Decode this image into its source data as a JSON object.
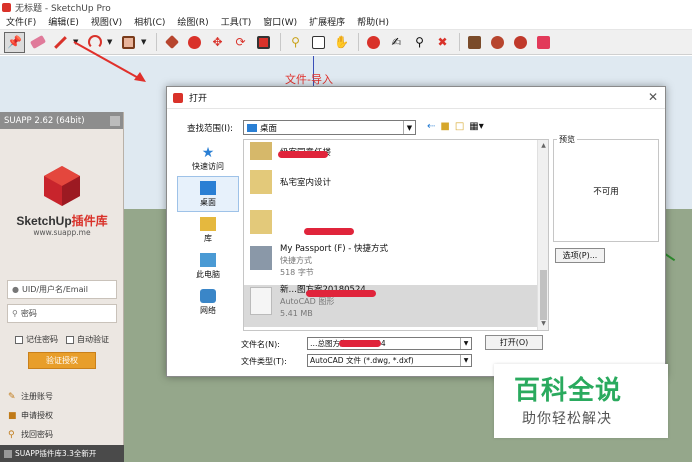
{
  "window": {
    "title": "无标题 - SketchUp Pro"
  },
  "menu": [
    "文件(F)",
    "编辑(E)",
    "视图(V)",
    "相机(C)",
    "绘图(R)",
    "工具(T)",
    "窗口(W)",
    "扩展程序",
    "帮助(H)"
  ],
  "annotation": {
    "text": "文件-导入",
    "color": "#e0302b"
  },
  "suapp": {
    "title": "SUAPP 2.62 (64bit)",
    "brand": "SketchUp",
    "brand_cn": "插件库",
    "url": "www.suapp.me",
    "uid_placeholder": "UID/用户名/Email",
    "password_placeholder": "密码",
    "remember_label": "记住密码",
    "auto_verify_label": "自动验证",
    "auth_button": "验证授权",
    "links": [
      "注册账号",
      "申请授权",
      "找回密码"
    ],
    "footer": "SUAPP插件库3.3全新开",
    "accent_color": "#e89e2a"
  },
  "dialog": {
    "title": "打开",
    "look_in_label": "查找范围(I):",
    "look_in_value": "桌面",
    "places": [
      "快速访问",
      "桌面",
      "库",
      "此电脑",
      "网络"
    ],
    "files": [
      {
        "name": "级客同意任楼",
        "sub": []
      },
      {
        "name": "私宅室内设计",
        "sub": []
      },
      {
        "name": "",
        "sub": []
      },
      {
        "name": "My Passport (F) - 快捷方式",
        "sub": [
          "快捷方式",
          "518 字节"
        ]
      },
      {
        "name": "新…图方案20180524",
        "sub": [
          "AutoCAD 图形",
          "5.41 MB"
        ]
      }
    ],
    "preview_label": "预览",
    "preview_text": "不可用",
    "options_button": "选项(P)...",
    "filename_label": "文件名(N):",
    "filename_value": "…总图方案20180524",
    "filetype_label": "文件类型(T):",
    "filetype_value": "AutoCAD 文件 (*.dwg, *.dxf)",
    "open_button": "打开(O)"
  },
  "watermark": {
    "title": "百科全说",
    "subtitle": "助你轻松解决",
    "color": "#2aaa5e"
  }
}
